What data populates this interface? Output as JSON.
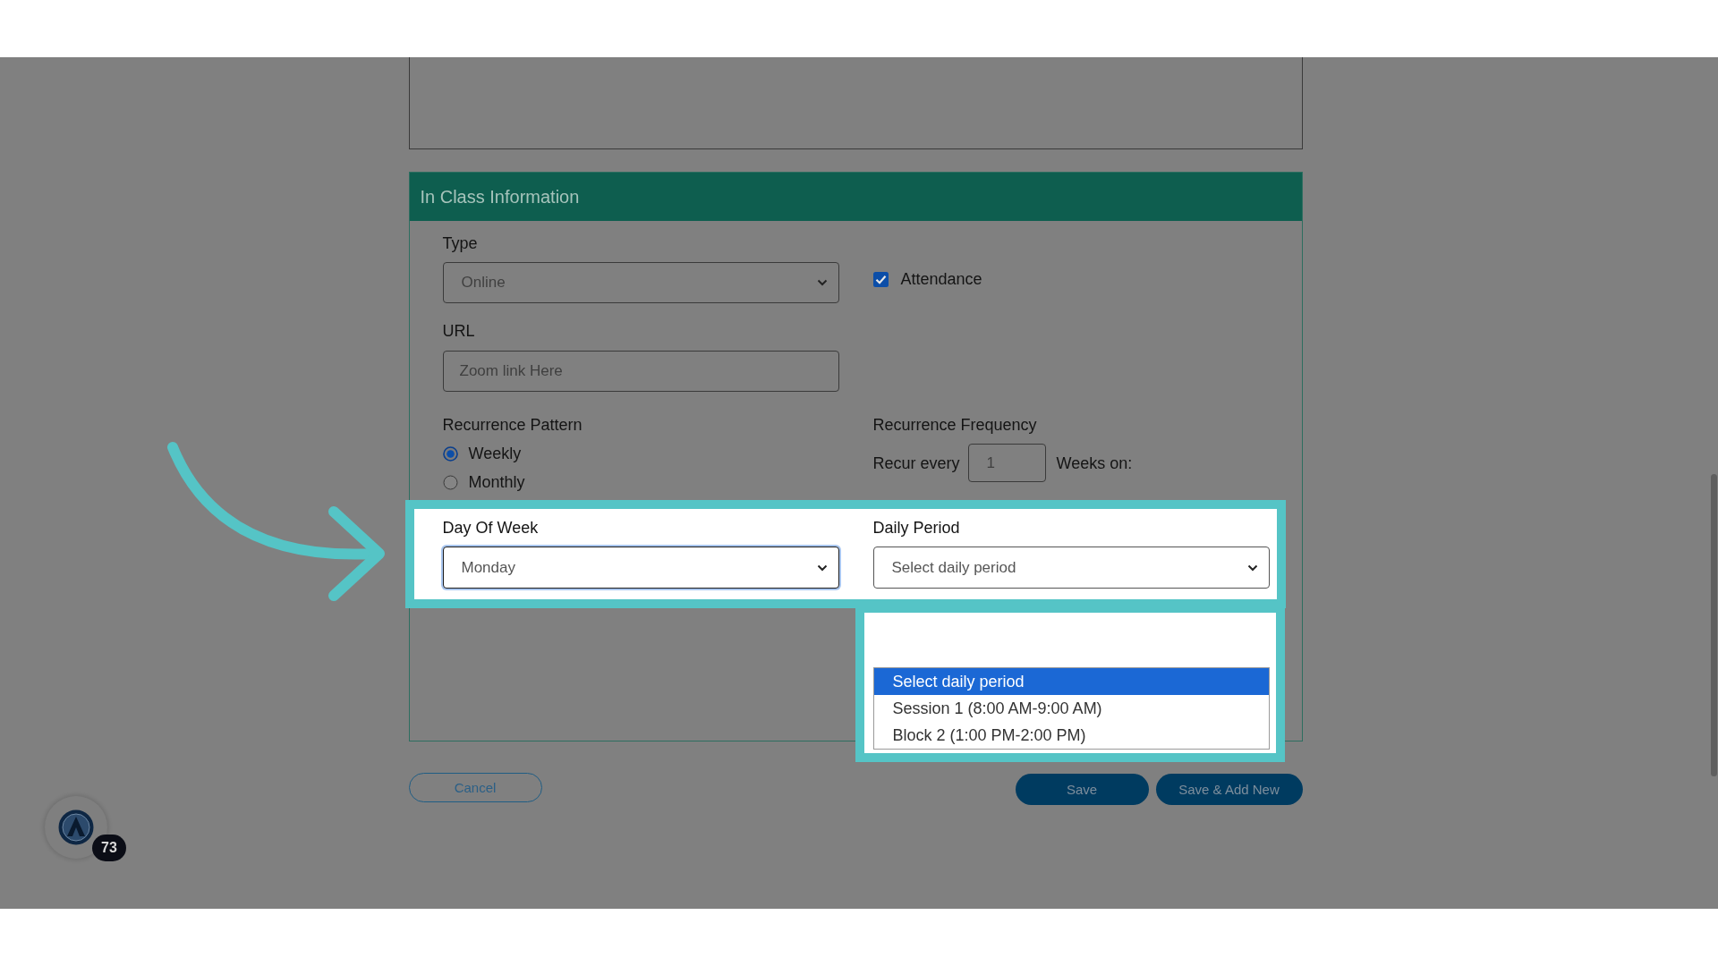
{
  "section": {
    "title": "In Class Information"
  },
  "type_field": {
    "label": "Type",
    "value": "Online"
  },
  "attendance": {
    "label": "Attendance",
    "checked": true
  },
  "url_field": {
    "label": "URL",
    "placeholder": "Zoom link Here"
  },
  "recurrence_pattern": {
    "label": "Recurrence Pattern",
    "options": [
      {
        "label": "Weekly",
        "selected": true
      },
      {
        "label": "Monthly",
        "selected": false
      }
    ]
  },
  "recurrence_frequency": {
    "label": "Recurrence Frequency",
    "prefix": "Recur every",
    "value": "1",
    "suffix": "Weeks on:"
  },
  "schedule": {
    "highlighted": true,
    "day_of_week": {
      "label": "Day Of Week",
      "value": "Monday",
      "focused": true
    },
    "daily_period": {
      "label": "Daily Period",
      "value": "Select daily period",
      "expanded": true,
      "options": [
        {
          "label": "Select daily period",
          "selected": true
        },
        {
          "label": "Session 1 (8:00 AM-9:00 AM)",
          "selected": false
        },
        {
          "label": "Block 2 (1:00 PM-2:00 PM)",
          "selected": false
        }
      ]
    }
  },
  "buttons": [
    {
      "label": "Cancel",
      "kind": "outline"
    },
    {
      "label": "Save",
      "kind": "primary"
    },
    {
      "label": "Save & Add New",
      "kind": "primary"
    }
  ],
  "floating_widget": {
    "count": "73"
  }
}
